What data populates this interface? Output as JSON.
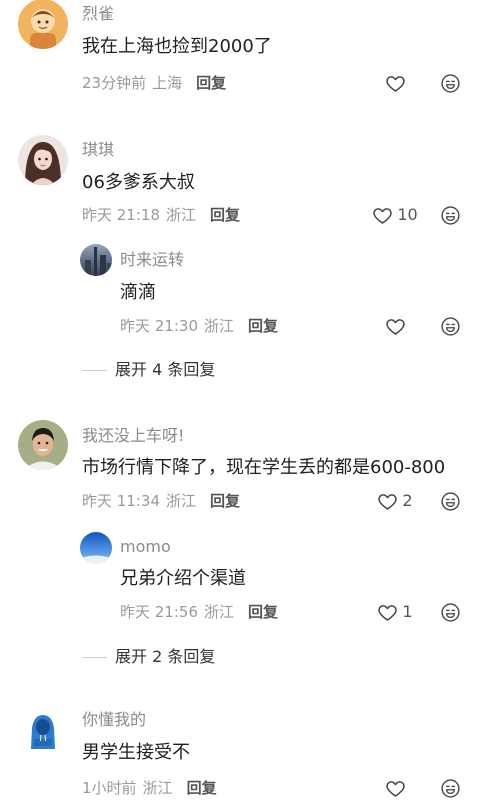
{
  "icons": {
    "like": "heart-outline-icon",
    "emoji": "emoji-face-icon"
  },
  "colors": {
    "author": "#8b8b8b",
    "text": "#1f1f1f",
    "meta": "#9a9a9a",
    "reply": "#555555"
  },
  "comments": [
    {
      "author": "烈雀",
      "text": "我在上海也捡到2000了",
      "time": "23分钟前",
      "location": "上海",
      "reply_label": "回复"
    },
    {
      "author": "琪琪",
      "text": "06多爹系大叔",
      "time": "昨天 21:18",
      "location": "浙江",
      "reply_label": "回复",
      "likes": "10",
      "replies": [
        {
          "author": "时来运转",
          "text": "滴滴",
          "time": "昨天 21:30",
          "location": "浙江",
          "reply_label": "回复"
        }
      ],
      "expand_label": "展开 4 条回复"
    },
    {
      "author": "我还没上车呀!",
      "text": "市场行情下降了，现在学生丢的都是600-800",
      "time": "昨天 11:34",
      "location": "浙江",
      "reply_label": "回复",
      "likes": "2",
      "replies": [
        {
          "author": "momo",
          "text": "兄弟介绍个渠道",
          "time": "昨天 21:56",
          "location": "浙江",
          "reply_label": "回复",
          "likes": "1"
        }
      ],
      "expand_label": "展开 2 条回复"
    },
    {
      "author": "你懂我的",
      "text": "男学生接受不",
      "time": "1小时前",
      "location": "浙江",
      "reply_label": "回复"
    }
  ]
}
